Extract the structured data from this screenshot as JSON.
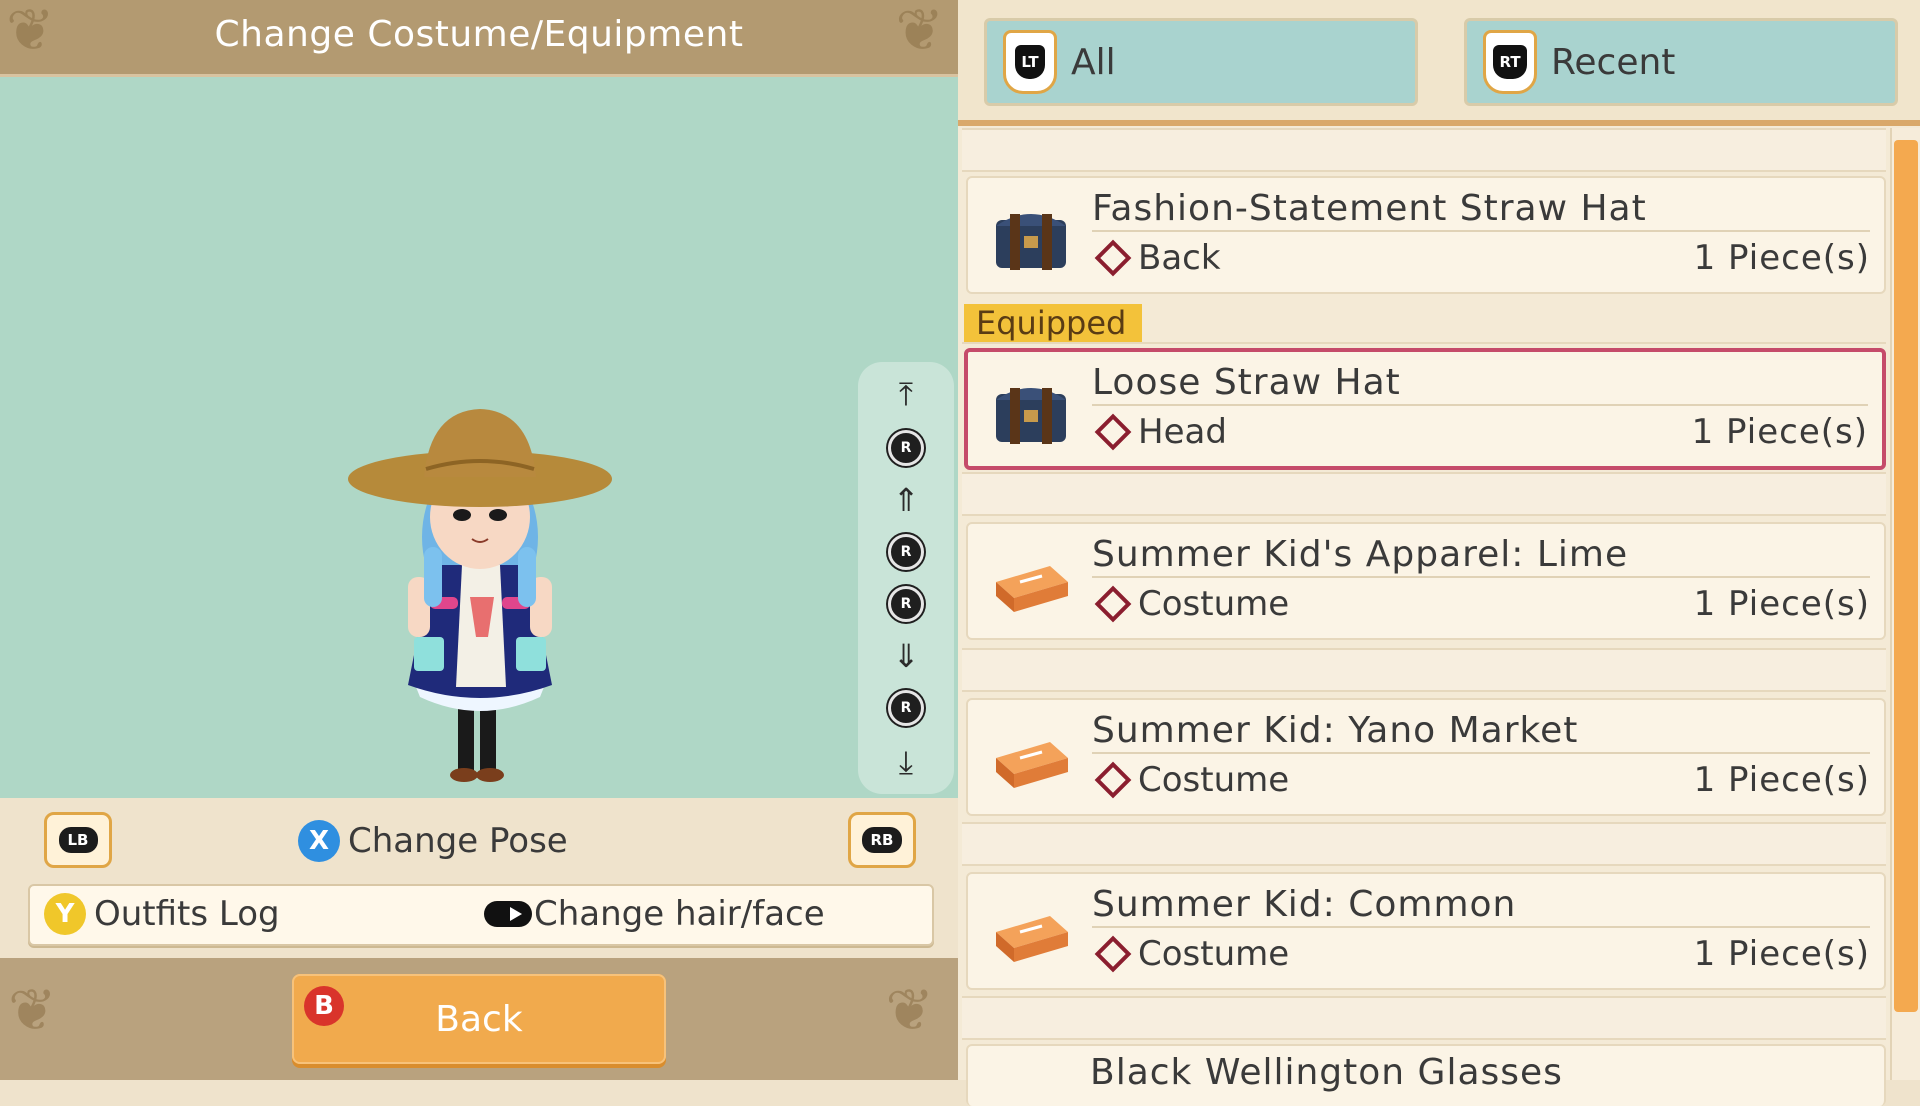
{
  "screen": {
    "title": "Change Costume/Equipment"
  },
  "controls": {
    "lb": "LB",
    "rb": "RB",
    "x_button": "X",
    "change_pose": "Change Pose",
    "y_button": "Y",
    "outfits_log": "Outfits Log",
    "change_hair_face": "Change hair/face",
    "b_button": "B",
    "back": "Back",
    "r_label": "R"
  },
  "tabs": [
    {
      "trigger": "LT",
      "label": "All"
    },
    {
      "trigger": "RT",
      "label": "Recent"
    }
  ],
  "equipped_label": "Equipped",
  "items": [
    {
      "name": "Fashion-Statement Straw Hat",
      "slot": "Back",
      "qty": "1 Piece(s)",
      "icon": "storage-chest-icon"
    },
    {
      "name": "Loose Straw Hat",
      "slot": "Head",
      "qty": "1 Piece(s)",
      "icon": "storage-chest-icon",
      "equipped": true
    },
    {
      "name": "Summer Kid's Apparel: Lime",
      "slot": "Costume",
      "qty": "1 Piece(s)",
      "icon": "costume-box-icon"
    },
    {
      "name": "Summer Kid: Yano Market",
      "slot": "Costume",
      "qty": "1 Piece(s)",
      "icon": "costume-box-icon"
    },
    {
      "name": "Summer Kid: Common",
      "slot": "Costume",
      "qty": "1 Piece(s)",
      "icon": "costume-box-icon"
    },
    {
      "name": "Black Wellington Glasses",
      "partial": true
    }
  ],
  "colors": {
    "preview_bg": "#afd7c6",
    "accent_orange": "#f1aa4d",
    "selection_border": "#c54b6a",
    "equipped_badge": "#f3c23a",
    "tab_bg": "#a9d3cf"
  }
}
